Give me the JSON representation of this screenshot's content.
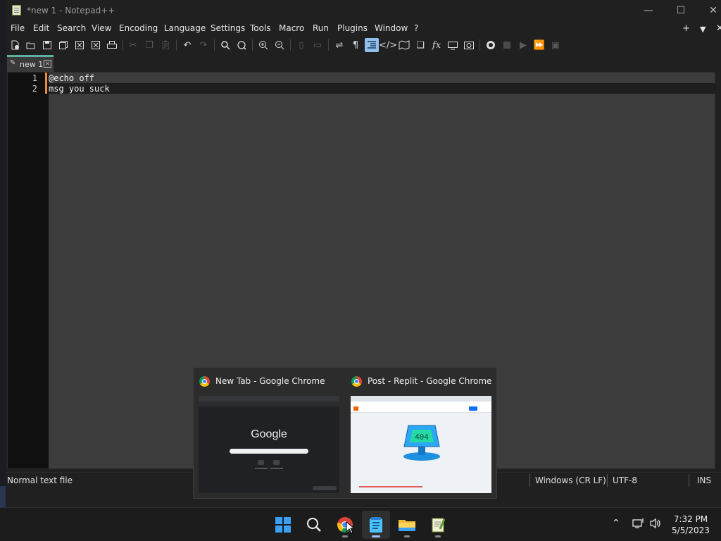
{
  "window": {
    "title": "*new 1 - Notepad++",
    "minimize": "—",
    "maximize": "☐",
    "close": "✕"
  },
  "menu": {
    "items": [
      "File",
      "Edit",
      "Search",
      "View",
      "Encoding",
      "Language",
      "Settings",
      "Tools",
      "Macro",
      "Run",
      "Plugins",
      "Window",
      "?"
    ],
    "right_add": "+",
    "right_list": "▼",
    "right_close": "✕"
  },
  "toolbar": {
    "icons": [
      "new-file-icon",
      "open-file-icon",
      "save-icon",
      "save-all-icon",
      "close-icon",
      "close-all-icon",
      "print-icon",
      "cut-icon",
      "copy-icon",
      "paste-icon",
      "undo-icon",
      "redo-icon",
      "find-icon",
      "replace-icon",
      "zoom-in-icon",
      "zoom-out-icon",
      "sync-vertical-icon",
      "sync-horizontal-icon",
      "word-wrap-icon",
      "show-all-chars-icon",
      "indent-guide-icon",
      "xml-tag-icon",
      "document-map-icon",
      "document-list-icon",
      "function-list-icon",
      "folder-workspace-icon",
      "monitoring-icon",
      "record-macro-icon",
      "stop-record-icon",
      "play-macro-icon",
      "run-macro-multiple-icon",
      "save-macro-icon"
    ],
    "active": "indent-guide-icon"
  },
  "tabs": [
    {
      "label": "new 1",
      "modified": true
    }
  ],
  "editor": {
    "lines": [
      {
        "number": "1",
        "text": "@echo off"
      },
      {
        "number": "2",
        "text": "msg you suck"
      }
    ],
    "current_line": 1
  },
  "status": {
    "file_type": "Normal text file",
    "eol": "Windows (CR LF)",
    "encoding": "UTF-8",
    "mode": "INS"
  },
  "taskbar_preview": {
    "windows": [
      {
        "title": "New Tab - Google Chrome",
        "thumb_logo": "Google"
      },
      {
        "title": "Post - Replit - Google Chrome",
        "thumb_logo": "404"
      }
    ]
  },
  "taskbar": {
    "apps": [
      "start-icon",
      "search-icon",
      "chrome-icon",
      "notepad-icon",
      "file-explorer-icon",
      "notepadpp-icon"
    ],
    "active": "notepad-icon",
    "clock_time": "7:32 PM",
    "clock_date": "5/5/2023"
  },
  "colors": {
    "accent_tab": "#5fb0a0",
    "change_marker": "#f08a3c",
    "toolbar_active": "#8fbfea"
  }
}
